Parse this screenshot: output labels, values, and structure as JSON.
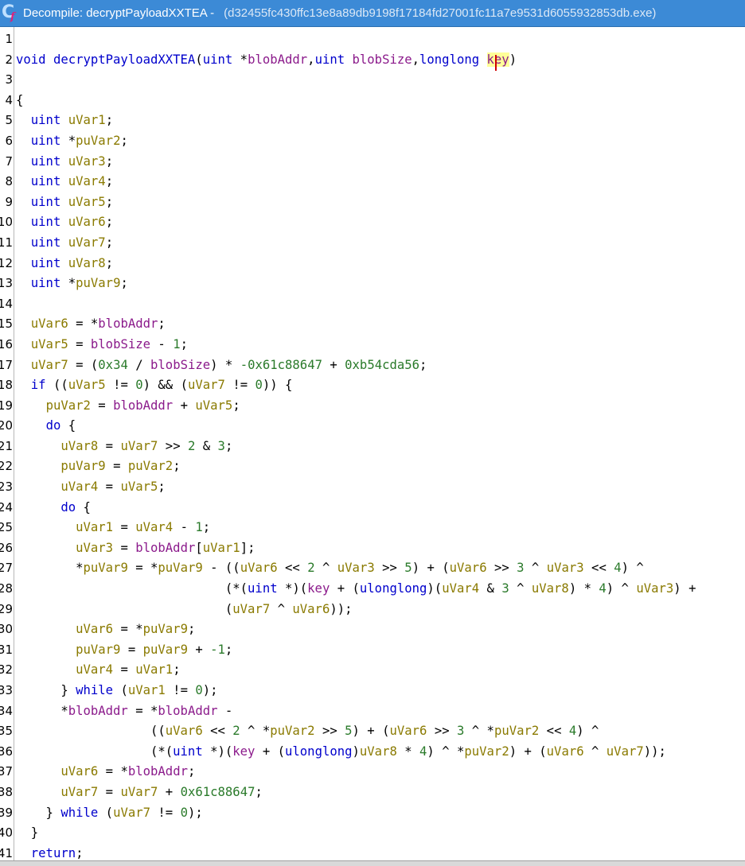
{
  "window": {
    "title": "Decompile: decryptPayloadXXTEA -",
    "file": "(d32455fc430ffc13e8a89db9198f17184fd27001fc11a7e9531d6055932853db.exe)"
  },
  "editor": {
    "line_numbers": [
      "1",
      "2",
      "3",
      "4",
      "5",
      "6",
      "7",
      "8",
      "9",
      "10",
      "11",
      "12",
      "13",
      "14",
      "15",
      "16",
      "17",
      "18",
      "19",
      "20",
      "21",
      "22",
      "23",
      "24",
      "25",
      "26",
      "27",
      "28",
      "29",
      "30",
      "31",
      "32",
      "33",
      "34",
      "35",
      "36",
      "37",
      "38",
      "39",
      "40",
      "41"
    ],
    "cursor_token": "key",
    "code_lines": [
      [],
      [
        [
          "fn",
          "void decryptPayloadXXTEA"
        ],
        [
          "op",
          "("
        ],
        [
          "ty",
          "uint"
        ],
        [
          "op",
          " *"
        ],
        [
          "pr",
          "blobAddr"
        ],
        [
          "op",
          ","
        ],
        [
          "ty",
          "uint"
        ],
        [
          "op",
          " "
        ],
        [
          "pr",
          "blobSize"
        ],
        [
          "op",
          ","
        ],
        [
          "ty",
          "longlong"
        ],
        [
          "op",
          " "
        ],
        [
          "hl",
          "key"
        ],
        [
          "op",
          ")"
        ]
      ],
      [],
      [
        [
          "op",
          "{"
        ]
      ],
      [
        [
          "op",
          "  "
        ],
        [
          "ty",
          "uint"
        ],
        [
          "op",
          " "
        ],
        [
          "lv",
          "uVar1"
        ],
        [
          "op",
          ";"
        ]
      ],
      [
        [
          "op",
          "  "
        ],
        [
          "ty",
          "uint"
        ],
        [
          "op",
          " *"
        ],
        [
          "lv",
          "puVar2"
        ],
        [
          "op",
          ";"
        ]
      ],
      [
        [
          "op",
          "  "
        ],
        [
          "ty",
          "uint"
        ],
        [
          "op",
          " "
        ],
        [
          "lv",
          "uVar3"
        ],
        [
          "op",
          ";"
        ]
      ],
      [
        [
          "op",
          "  "
        ],
        [
          "ty",
          "uint"
        ],
        [
          "op",
          " "
        ],
        [
          "lv",
          "uVar4"
        ],
        [
          "op",
          ";"
        ]
      ],
      [
        [
          "op",
          "  "
        ],
        [
          "ty",
          "uint"
        ],
        [
          "op",
          " "
        ],
        [
          "lv",
          "uVar5"
        ],
        [
          "op",
          ";"
        ]
      ],
      [
        [
          "op",
          "  "
        ],
        [
          "ty",
          "uint"
        ],
        [
          "op",
          " "
        ],
        [
          "lv",
          "uVar6"
        ],
        [
          "op",
          ";"
        ]
      ],
      [
        [
          "op",
          "  "
        ],
        [
          "ty",
          "uint"
        ],
        [
          "op",
          " "
        ],
        [
          "lv",
          "uVar7"
        ],
        [
          "op",
          ";"
        ]
      ],
      [
        [
          "op",
          "  "
        ],
        [
          "ty",
          "uint"
        ],
        [
          "op",
          " "
        ],
        [
          "lv",
          "uVar8"
        ],
        [
          "op",
          ";"
        ]
      ],
      [
        [
          "op",
          "  "
        ],
        [
          "ty",
          "uint"
        ],
        [
          "op",
          " *"
        ],
        [
          "lv",
          "puVar9"
        ],
        [
          "op",
          ";"
        ]
      ],
      [],
      [
        [
          "op",
          "  "
        ],
        [
          "lv",
          "uVar6"
        ],
        [
          "op",
          " = *"
        ],
        [
          "pr",
          "blobAddr"
        ],
        [
          "op",
          ";"
        ]
      ],
      [
        [
          "op",
          "  "
        ],
        [
          "lv",
          "uVar5"
        ],
        [
          "op",
          " = "
        ],
        [
          "pr",
          "blobSize"
        ],
        [
          "op",
          " - "
        ],
        [
          "nm",
          "1"
        ],
        [
          "op",
          ";"
        ]
      ],
      [
        [
          "op",
          "  "
        ],
        [
          "lv",
          "uVar7"
        ],
        [
          "op",
          " = ("
        ],
        [
          "nm",
          "0x34"
        ],
        [
          "op",
          " / "
        ],
        [
          "pr",
          "blobSize"
        ],
        [
          "op",
          ") * "
        ],
        [
          "nm",
          "-0x61c88647"
        ],
        [
          "op",
          " + "
        ],
        [
          "nm",
          "0xb54cda56"
        ],
        [
          "op",
          ";"
        ]
      ],
      [
        [
          "op",
          "  "
        ],
        [
          "kw",
          "if"
        ],
        [
          "op",
          " (("
        ],
        [
          "lv",
          "uVar5"
        ],
        [
          "op",
          " != "
        ],
        [
          "nm",
          "0"
        ],
        [
          "op",
          ") && ("
        ],
        [
          "lv",
          "uVar7"
        ],
        [
          "op",
          " != "
        ],
        [
          "nm",
          "0"
        ],
        [
          "op",
          ")) {"
        ]
      ],
      [
        [
          "op",
          "    "
        ],
        [
          "lv",
          "puVar2"
        ],
        [
          "op",
          " = "
        ],
        [
          "pr",
          "blobAddr"
        ],
        [
          "op",
          " + "
        ],
        [
          "lv",
          "uVar5"
        ],
        [
          "op",
          ";"
        ]
      ],
      [
        [
          "op",
          "    "
        ],
        [
          "kw",
          "do"
        ],
        [
          "op",
          " {"
        ]
      ],
      [
        [
          "op",
          "      "
        ],
        [
          "lv",
          "uVar8"
        ],
        [
          "op",
          " = "
        ],
        [
          "lv",
          "uVar7"
        ],
        [
          "op",
          " >> "
        ],
        [
          "nm",
          "2"
        ],
        [
          "op",
          " & "
        ],
        [
          "nm",
          "3"
        ],
        [
          "op",
          ";"
        ]
      ],
      [
        [
          "op",
          "      "
        ],
        [
          "lv",
          "puVar9"
        ],
        [
          "op",
          " = "
        ],
        [
          "lv",
          "puVar2"
        ],
        [
          "op",
          ";"
        ]
      ],
      [
        [
          "op",
          "      "
        ],
        [
          "lv",
          "uVar4"
        ],
        [
          "op",
          " = "
        ],
        [
          "lv",
          "uVar5"
        ],
        [
          "op",
          ";"
        ]
      ],
      [
        [
          "op",
          "      "
        ],
        [
          "kw",
          "do"
        ],
        [
          "op",
          " {"
        ]
      ],
      [
        [
          "op",
          "        "
        ],
        [
          "lv",
          "uVar1"
        ],
        [
          "op",
          " = "
        ],
        [
          "lv",
          "uVar4"
        ],
        [
          "op",
          " - "
        ],
        [
          "nm",
          "1"
        ],
        [
          "op",
          ";"
        ]
      ],
      [
        [
          "op",
          "        "
        ],
        [
          "lv",
          "uVar3"
        ],
        [
          "op",
          " = "
        ],
        [
          "pr",
          "blobAddr"
        ],
        [
          "op",
          "["
        ],
        [
          "lv",
          "uVar1"
        ],
        [
          "op",
          "];"
        ]
      ],
      [
        [
          "op",
          "        *"
        ],
        [
          "lv",
          "puVar9"
        ],
        [
          "op",
          " = *"
        ],
        [
          "lv",
          "puVar9"
        ],
        [
          "op",
          " - (("
        ],
        [
          "lv",
          "uVar6"
        ],
        [
          "op",
          " << "
        ],
        [
          "nm",
          "2"
        ],
        [
          "op",
          " ^ "
        ],
        [
          "lv",
          "uVar3"
        ],
        [
          "op",
          " >> "
        ],
        [
          "nm",
          "5"
        ],
        [
          "op",
          ") + ("
        ],
        [
          "lv",
          "uVar6"
        ],
        [
          "op",
          " >> "
        ],
        [
          "nm",
          "3"
        ],
        [
          "op",
          " ^ "
        ],
        [
          "lv",
          "uVar3"
        ],
        [
          "op",
          " << "
        ],
        [
          "nm",
          "4"
        ],
        [
          "op",
          ") ^"
        ]
      ],
      [
        [
          "op",
          "                            (*("
        ],
        [
          "ty",
          "uint"
        ],
        [
          "op",
          " *)("
        ],
        [
          "pr",
          "key"
        ],
        [
          "op",
          " + ("
        ],
        [
          "ty",
          "ulonglong"
        ],
        [
          "op",
          ")("
        ],
        [
          "lv",
          "uVar4"
        ],
        [
          "op",
          " & "
        ],
        [
          "nm",
          "3"
        ],
        [
          "op",
          " ^ "
        ],
        [
          "lv",
          "uVar8"
        ],
        [
          "op",
          ") * "
        ],
        [
          "nm",
          "4"
        ],
        [
          "op",
          ") ^ "
        ],
        [
          "lv",
          "uVar3"
        ],
        [
          "op",
          ") +"
        ]
      ],
      [
        [
          "op",
          "                            ("
        ],
        [
          "lv",
          "uVar7"
        ],
        [
          "op",
          " ^ "
        ],
        [
          "lv",
          "uVar6"
        ],
        [
          "op",
          "));"
        ]
      ],
      [
        [
          "op",
          "        "
        ],
        [
          "lv",
          "uVar6"
        ],
        [
          "op",
          " = *"
        ],
        [
          "lv",
          "puVar9"
        ],
        [
          "op",
          ";"
        ]
      ],
      [
        [
          "op",
          "        "
        ],
        [
          "lv",
          "puVar9"
        ],
        [
          "op",
          " = "
        ],
        [
          "lv",
          "puVar9"
        ],
        [
          "op",
          " + "
        ],
        [
          "nm",
          "-1"
        ],
        [
          "op",
          ";"
        ]
      ],
      [
        [
          "op",
          "        "
        ],
        [
          "lv",
          "uVar4"
        ],
        [
          "op",
          " = "
        ],
        [
          "lv",
          "uVar1"
        ],
        [
          "op",
          ";"
        ]
      ],
      [
        [
          "op",
          "      } "
        ],
        [
          "kw",
          "while"
        ],
        [
          "op",
          " ("
        ],
        [
          "lv",
          "uVar1"
        ],
        [
          "op",
          " != "
        ],
        [
          "nm",
          "0"
        ],
        [
          "op",
          ");"
        ]
      ],
      [
        [
          "op",
          "      *"
        ],
        [
          "pr",
          "blobAddr"
        ],
        [
          "op",
          " = *"
        ],
        [
          "pr",
          "blobAddr"
        ],
        [
          "op",
          " -"
        ]
      ],
      [
        [
          "op",
          "                  (("
        ],
        [
          "lv",
          "uVar6"
        ],
        [
          "op",
          " << "
        ],
        [
          "nm",
          "2"
        ],
        [
          "op",
          " ^ *"
        ],
        [
          "lv",
          "puVar2"
        ],
        [
          "op",
          " >> "
        ],
        [
          "nm",
          "5"
        ],
        [
          "op",
          ") + ("
        ],
        [
          "lv",
          "uVar6"
        ],
        [
          "op",
          " >> "
        ],
        [
          "nm",
          "3"
        ],
        [
          "op",
          " ^ *"
        ],
        [
          "lv",
          "puVar2"
        ],
        [
          "op",
          " << "
        ],
        [
          "nm",
          "4"
        ],
        [
          "op",
          ") ^"
        ]
      ],
      [
        [
          "op",
          "                  (*("
        ],
        [
          "ty",
          "uint"
        ],
        [
          "op",
          " *)("
        ],
        [
          "pr",
          "key"
        ],
        [
          "op",
          " + ("
        ],
        [
          "ty",
          "ulonglong"
        ],
        [
          "op",
          ")"
        ],
        [
          "lv",
          "uVar8"
        ],
        [
          "op",
          " * "
        ],
        [
          "nm",
          "4"
        ],
        [
          "op",
          ") ^ *"
        ],
        [
          "lv",
          "puVar2"
        ],
        [
          "op",
          ") + ("
        ],
        [
          "lv",
          "uVar6"
        ],
        [
          "op",
          " ^ "
        ],
        [
          "lv",
          "uVar7"
        ],
        [
          "op",
          "));"
        ]
      ],
      [
        [
          "op",
          "      "
        ],
        [
          "lv",
          "uVar6"
        ],
        [
          "op",
          " = *"
        ],
        [
          "pr",
          "blobAddr"
        ],
        [
          "op",
          ";"
        ]
      ],
      [
        [
          "op",
          "      "
        ],
        [
          "lv",
          "uVar7"
        ],
        [
          "op",
          " = "
        ],
        [
          "lv",
          "uVar7"
        ],
        [
          "op",
          " + "
        ],
        [
          "nm",
          "0x61c88647"
        ],
        [
          "op",
          ";"
        ]
      ],
      [
        [
          "op",
          "    } "
        ],
        [
          "kw",
          "while"
        ],
        [
          "op",
          " ("
        ],
        [
          "lv",
          "uVar7"
        ],
        [
          "op",
          " != "
        ],
        [
          "nm",
          "0"
        ],
        [
          "op",
          ");"
        ]
      ],
      [
        [
          "op",
          "  }"
        ]
      ],
      [
        [
          "op",
          "  "
        ],
        [
          "kw",
          "return"
        ],
        [
          "op",
          ";"
        ]
      ]
    ]
  }
}
